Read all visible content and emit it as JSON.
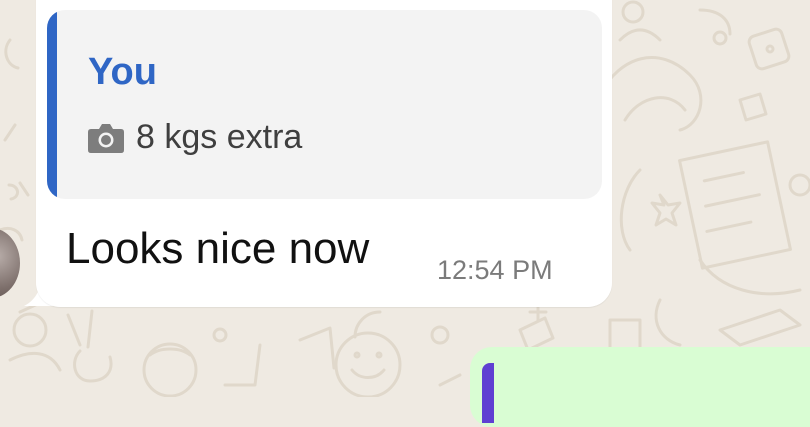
{
  "message": {
    "reply_quote": {
      "author": "You",
      "icon": "camera-icon",
      "text": "8 kgs extra",
      "accent_color": "#2f66c5"
    },
    "text": "Looks nice now",
    "time": "12:54 PM"
  },
  "colors": {
    "wallpaper": "#efeae2",
    "incoming_bubble": "#ffffff",
    "outgoing_bubble": "#d9fdd3",
    "outgoing_quote_bar": "#5f3fd2"
  }
}
